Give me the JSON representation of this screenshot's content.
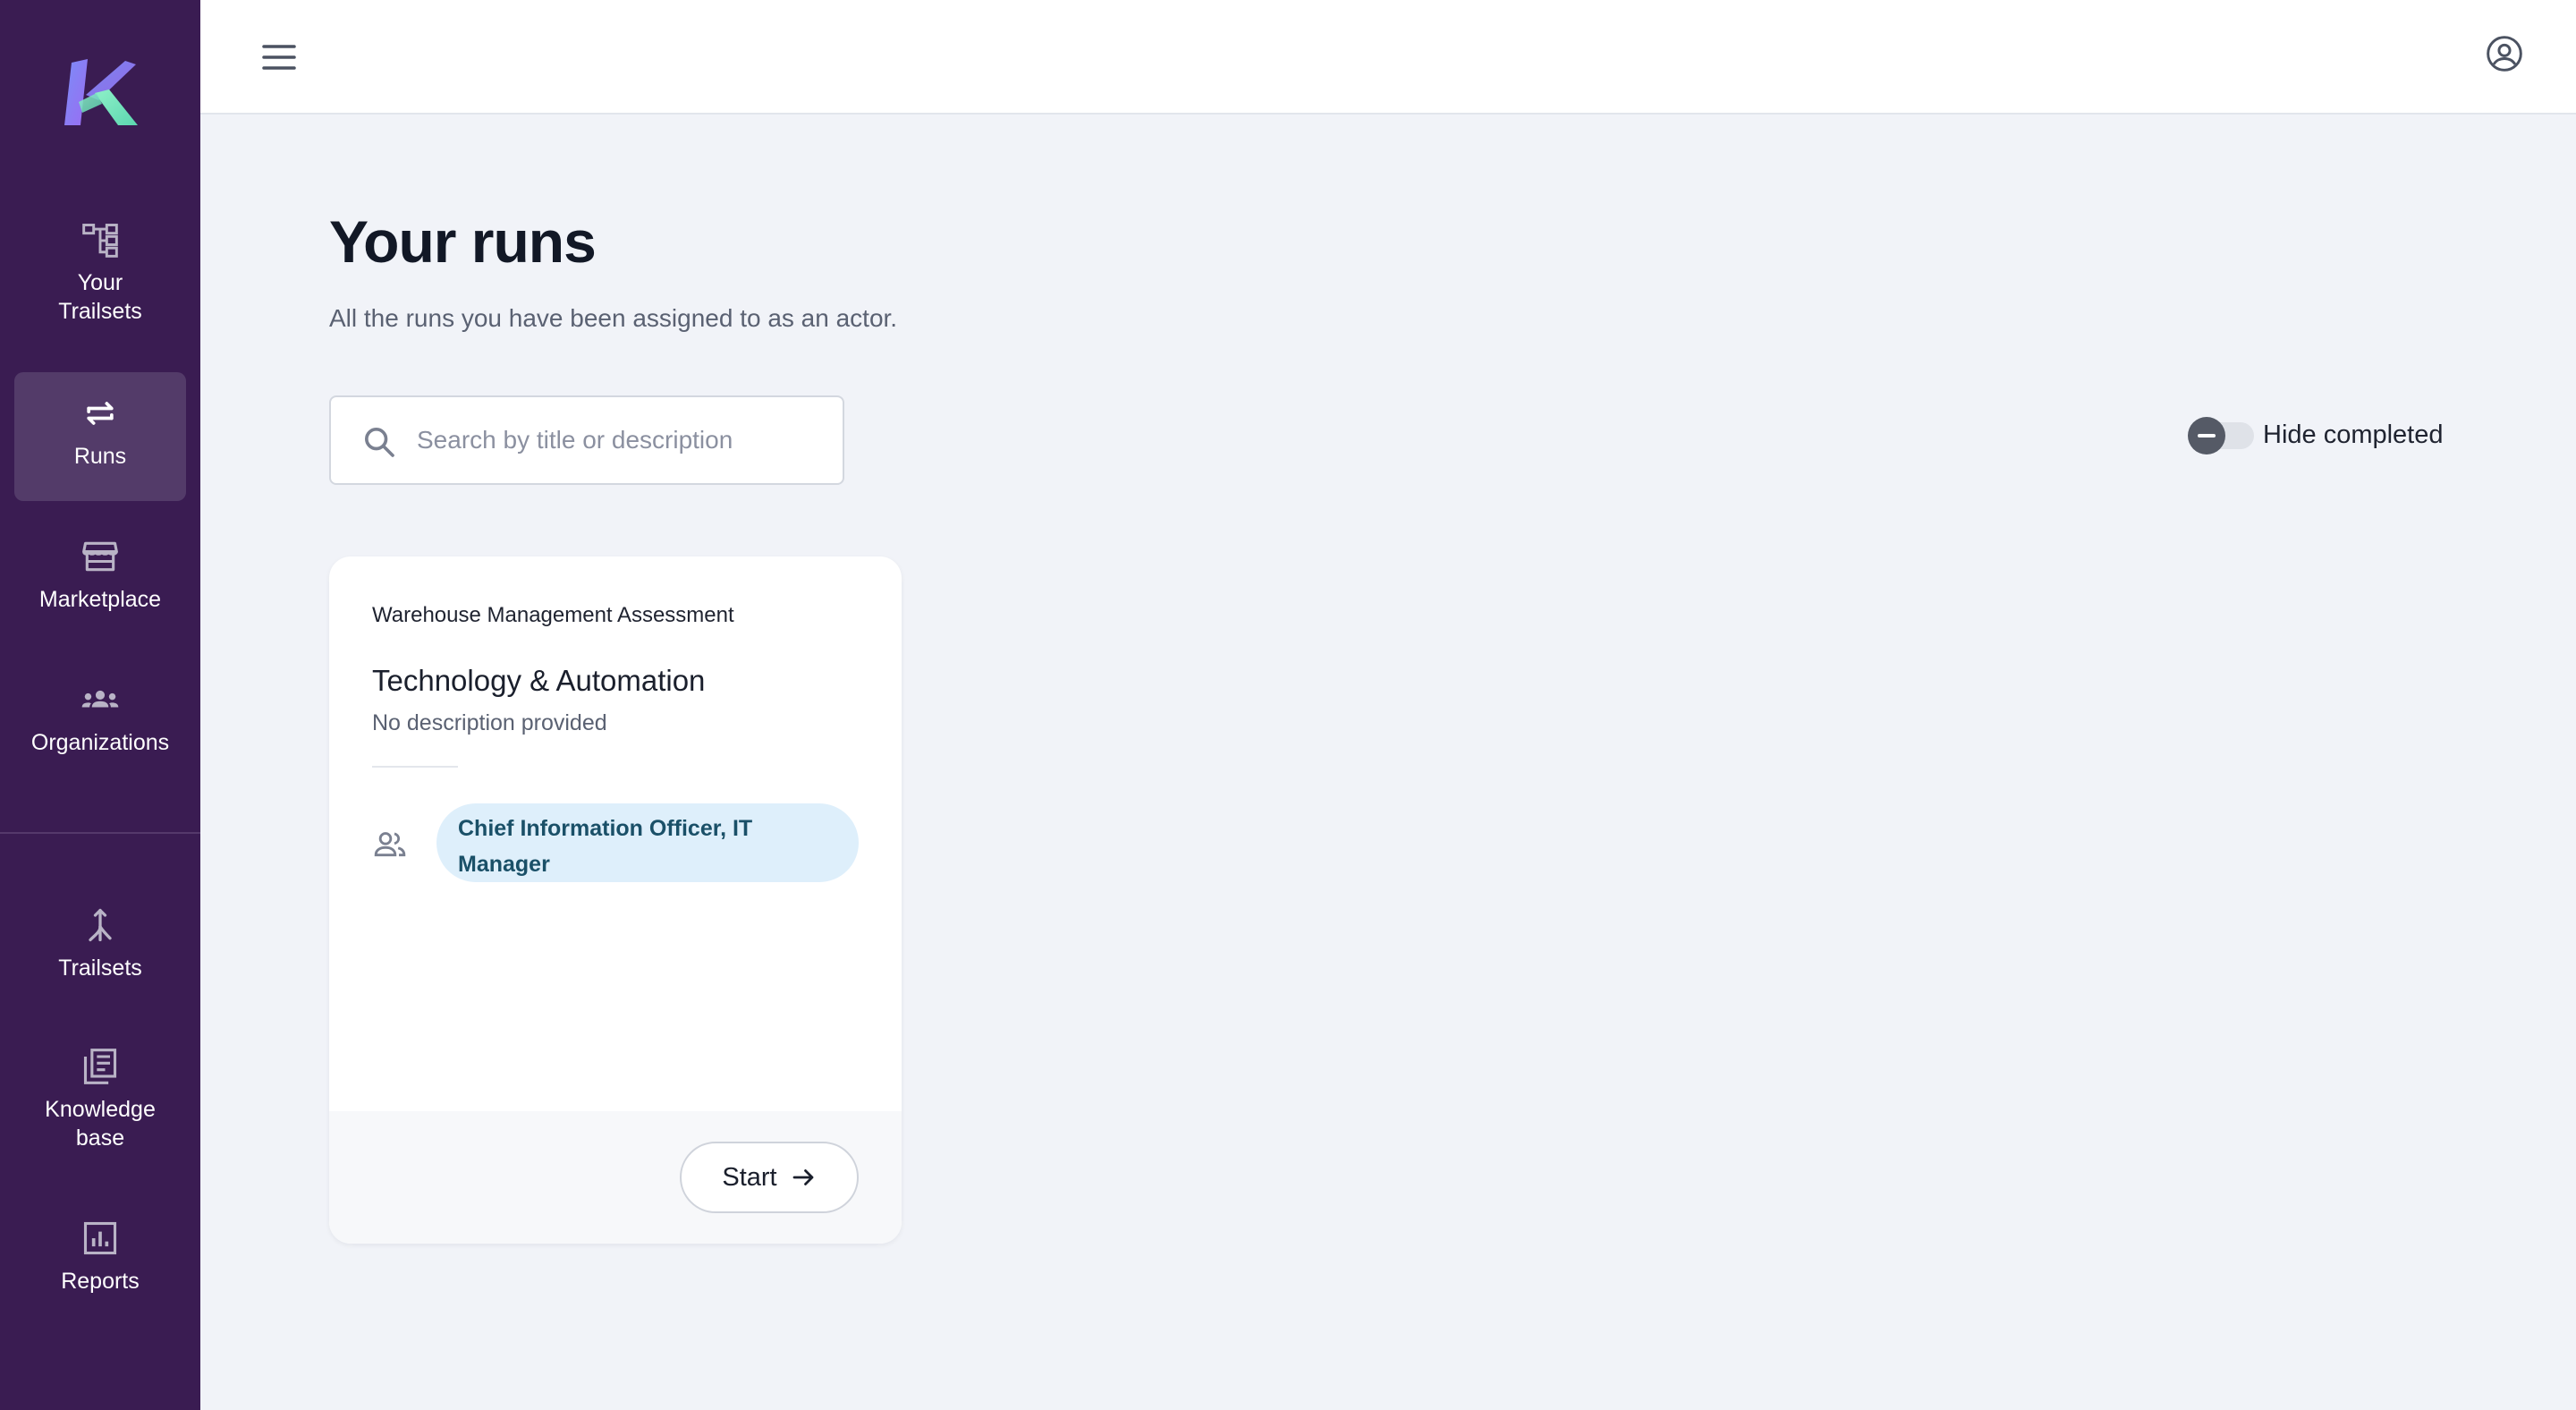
{
  "sidebar": {
    "logo_icon": "k-logo",
    "items": [
      {
        "label": "Your Trailsets",
        "icon": "hierarchy-icon"
      },
      {
        "label": "Runs",
        "icon": "repeat-arrows-icon",
        "active": true
      },
      {
        "label": "Marketplace",
        "icon": "storefront-icon"
      },
      {
        "label": "Organizations",
        "icon": "groups-icon"
      },
      {
        "label": "Trailsets",
        "icon": "merge-icon"
      },
      {
        "label": "Knowledge base",
        "icon": "library-books-icon"
      },
      {
        "label": "Reports",
        "icon": "bar-chart-icon"
      }
    ]
  },
  "topbar": {
    "menu_icon": "hamburger-menu-icon",
    "account_icon": "account-circle-icon"
  },
  "main": {
    "title": "Your runs",
    "subtitle": "All the runs you have been assigned to as an actor.",
    "search": {
      "placeholder": "Search by title or description",
      "value": ""
    },
    "hide_completed": {
      "label": "Hide completed",
      "checked": false
    }
  },
  "cards": [
    {
      "overline": "Warehouse Management Assessment",
      "title": "Technology & Automation",
      "description": "No description provided",
      "actors": "Chief Information Officer, IT Manager",
      "action_label": "Start"
    }
  ],
  "colors": {
    "sidebar": "#3a1c52",
    "sidebar_active": "#533b69",
    "page_background": "#f1f3f8",
    "actor_chip": "#deeffb",
    "actor_chip_text": "#1a5068"
  }
}
